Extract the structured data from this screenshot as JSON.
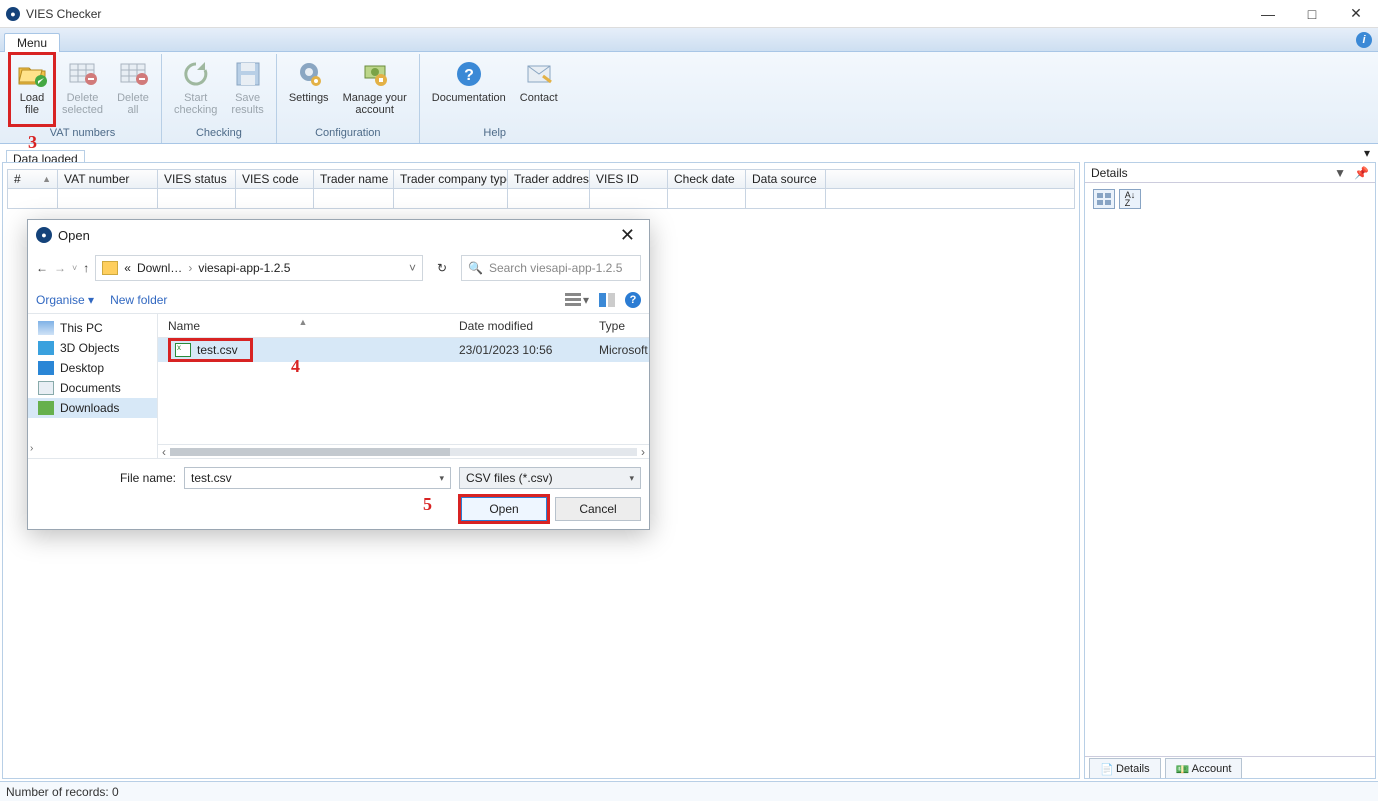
{
  "window": {
    "title": "VIES Checker",
    "min": "—",
    "max": "□",
    "close": "✕"
  },
  "menu": {
    "tab": "Menu"
  },
  "ribbon": {
    "groups": [
      {
        "caption": "VAT numbers",
        "buttons": [
          {
            "label_line1": "Load",
            "label_line2": "file"
          },
          {
            "label_line1": "Delete",
            "label_line2": "selected"
          },
          {
            "label_line1": "Delete",
            "label_line2": "all"
          }
        ]
      },
      {
        "caption": "Checking",
        "buttons": [
          {
            "label_line1": "Start",
            "label_line2": "checking"
          },
          {
            "label_line1": "Save",
            "label_line2": "results"
          }
        ]
      },
      {
        "caption": "Configuration",
        "buttons": [
          {
            "label_line1": "Settings",
            "label_line2": ""
          },
          {
            "label_line1": "Manage your",
            "label_line2": "account"
          }
        ]
      },
      {
        "caption": "Help",
        "buttons": [
          {
            "label_line1": "Documentation",
            "label_line2": ""
          },
          {
            "label_line1": "Contact",
            "label_line2": ""
          }
        ]
      }
    ]
  },
  "dataPanel": {
    "title": "Data loaded",
    "columns": [
      "#",
      "VAT number",
      "VIES status",
      "VIES code",
      "Trader name",
      "Trader company type",
      "Trader address",
      "VIES ID",
      "Check date",
      "Data source"
    ]
  },
  "details": {
    "title": "Details",
    "tabs": {
      "details": "Details",
      "account": "Account"
    }
  },
  "status": {
    "text": "Number of records: 0"
  },
  "dialog": {
    "title": "Open",
    "breadcrumb": {
      "root": "«",
      "p1": "Downl…",
      "p2": "viesapi-app-1.2.5"
    },
    "search_placeholder": "Search viesapi-app-1.2.5",
    "organise": "Organise",
    "newfolder": "New folder",
    "navitems": {
      "pc": "This PC",
      "threed": "3D Objects",
      "desktop": "Desktop",
      "documents": "Documents",
      "downloads": "Downloads"
    },
    "cols": {
      "name": "Name",
      "dm": "Date modified",
      "type": "Type"
    },
    "file": {
      "name": "test.csv",
      "dm": "23/01/2023 10:56",
      "type": "Microsoft"
    },
    "filenamelabel": "File name:",
    "filename": "test.csv",
    "filetype": "CSV files (*.csv)",
    "open": "Open",
    "cancel": "Cancel"
  },
  "annotations": {
    "a3": "3",
    "a4": "4",
    "a5": "5"
  }
}
